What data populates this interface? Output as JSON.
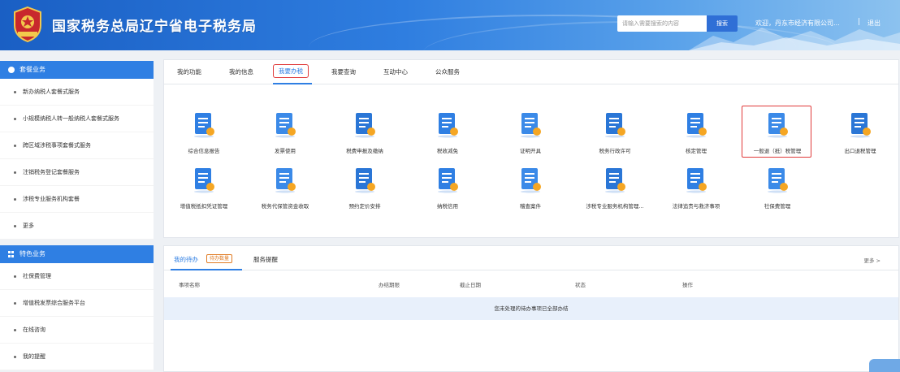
{
  "header": {
    "title": "国家税务总局辽宁省电子税务局",
    "search_placeholder": "请输入需要搜索的内容",
    "search_button": "搜索",
    "welcome": "欢迎，丹东市经济有限公司...",
    "separator": "|",
    "logout": "退出"
  },
  "sidebar": {
    "section1": {
      "title": "套餐业务",
      "items": [
        "新办纳税人套餐式服务",
        "小规模纳税人转一般纳税人套餐式服务",
        "跨区域涉税事项套餐式服务",
        "注销税务登记套餐服务",
        "涉税专业服务机构套餐",
        "更多"
      ]
    },
    "section2": {
      "title": "特色业务",
      "items": [
        "社保费管理",
        "增值税发票综合服务平台",
        "在线咨询",
        "我的提醒"
      ]
    }
  },
  "tabs": [
    "我的功能",
    "我的信息",
    "我要办税",
    "我要查询",
    "互动中心",
    "公众服务"
  ],
  "services": [
    {
      "label": "综合信息报告",
      "icon": "report-icon"
    },
    {
      "label": "发票使用",
      "icon": "invoice-icon"
    },
    {
      "label": "税费申报及缴纳",
      "icon": "tax-payment-icon"
    },
    {
      "label": "税收减免",
      "icon": "tax-relief-icon"
    },
    {
      "label": "证明开具",
      "icon": "certificate-icon"
    },
    {
      "label": "税务行政许可",
      "icon": "license-icon"
    },
    {
      "label": "核定管理",
      "icon": "verification-icon"
    },
    {
      "label": "一般退（抵）税管理",
      "icon": "refund-icon"
    },
    {
      "label": "出口退税管理",
      "icon": "export-refund-icon"
    },
    {
      "label": "增值税抵扣凭证管理",
      "icon": "deduction-icon"
    },
    {
      "label": "税务代保管资金收取",
      "icon": "fund-icon"
    },
    {
      "label": "预约定价安排",
      "icon": "pricing-icon"
    },
    {
      "label": "纳税信用",
      "icon": "credit-icon"
    },
    {
      "label": "稽查案件",
      "icon": "inspection-icon"
    },
    {
      "label": "涉税专业服务机构管理...",
      "icon": "agency-icon"
    },
    {
      "label": "法律追责与救济事项",
      "icon": "legal-icon"
    },
    {
      "label": "社保费管理",
      "icon": "social-insurance-icon"
    }
  ],
  "lower": {
    "tab1": "我的待办",
    "badge": "待办数量",
    "tab2": "服务提醒",
    "more": "更多 >",
    "columns": [
      "事项名称",
      "办结期限",
      "截止日期",
      "状态",
      "操作"
    ],
    "empty_text": "您未处理的待办事项已全部办结"
  },
  "colors": {
    "primary": "#2f7fe3",
    "highlight": "#e03a3a"
  }
}
